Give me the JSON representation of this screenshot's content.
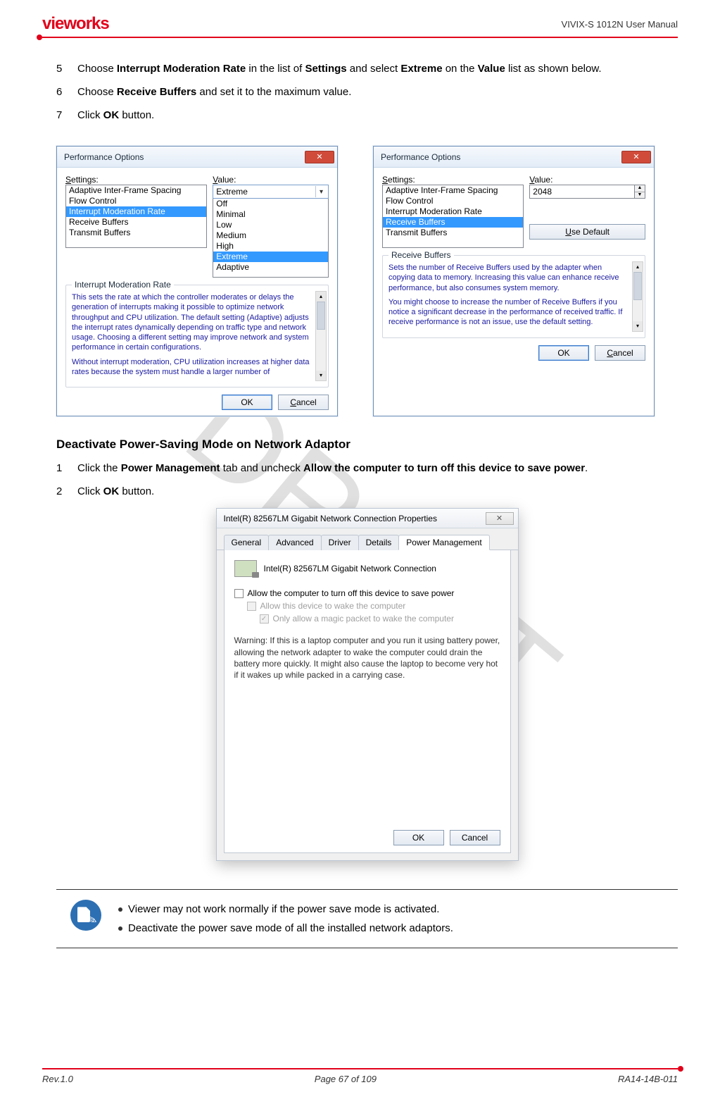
{
  "header": {
    "logo": "vieworks",
    "doc_title": "VIVIX-S 1012N User Manual"
  },
  "watermark": "DRAFT",
  "steps_a": [
    {
      "n": "5",
      "pre": "Choose ",
      "b1": "Interrupt Moderation Rate",
      "mid1": " in the list of ",
      "b2": "Settings",
      "mid2": " and select ",
      "b3": "Extreme",
      "mid3": " on the ",
      "b4": "Value",
      "post": " list as shown below."
    },
    {
      "n": "6",
      "pre": "Choose ",
      "b1": "Receive Buffers",
      "mid1": " and set it to the maximum value."
    },
    {
      "n": "7",
      "pre": "Click ",
      "b1": "OK",
      "mid1": " button."
    }
  ],
  "perf1": {
    "title": "Performance Options",
    "settings_label": "Settings:",
    "value_label": "Value:",
    "settings": [
      "Adaptive Inter-Frame Spacing",
      "Flow Control",
      "Interrupt Moderation Rate",
      "Receive Buffers",
      "Transmit Buffers"
    ],
    "selected_setting_index": 2,
    "value_selected": "Extreme",
    "dropdown": [
      "Off",
      "Minimal",
      "Low",
      "Medium",
      "High",
      "Extreme",
      "Adaptive"
    ],
    "dropdown_sel_index": 5,
    "legend": "Interrupt Moderation Rate",
    "desc_p1": "This sets the rate at which the controller moderates or delays the generation of interrupts making it possible to optimize network throughput and CPU utilization. The default setting (Adaptive) adjusts the interrupt rates dynamically depending on traffic type and network usage. Choosing a different setting may improve network and system performance in certain configurations.",
    "desc_p2": "Without interrupt moderation, CPU utilization increases at higher data rates because the system must handle a larger number of",
    "ok": "OK",
    "cancel": "Cancel"
  },
  "perf2": {
    "title": "Performance Options",
    "settings_label": "Settings:",
    "value_label": "Value:",
    "settings": [
      "Adaptive Inter-Frame Spacing",
      "Flow Control",
      "Interrupt Moderation Rate",
      "Receive Buffers",
      "Transmit Buffers"
    ],
    "selected_setting_index": 3,
    "value_text": "2048",
    "use_default": "Use Default",
    "legend": "Receive Buffers",
    "desc_p1": "Sets the number of Receive Buffers used by the adapter when copying data to memory. Increasing this value can enhance receive performance, but also consumes system memory.",
    "desc_p2": "You might choose to increase the number of Receive Buffers if you notice a significant decrease in the performance of received traffic. If receive performance is not an issue, use the default setting.",
    "ok": "OK",
    "cancel": "Cancel"
  },
  "section_heading": "Deactivate Power-Saving Mode on Network Adaptor",
  "steps_b": [
    {
      "n": "1",
      "pre": "Click the ",
      "b1": "Power Management",
      "mid1": " tab and uncheck ",
      "b2": "Allow the computer to turn off this device to save power",
      "post": "."
    },
    {
      "n": "2",
      "pre": "Click ",
      "b1": "OK",
      "mid1": " button."
    }
  ],
  "net": {
    "title": "Intel(R) 82567LM Gigabit Network Connection Properties",
    "tabs": [
      "General",
      "Advanced",
      "Driver",
      "Details",
      "Power Management"
    ],
    "active_tab_index": 4,
    "device": "Intel(R) 82567LM Gigabit Network Connection",
    "cb1": "Allow the computer to turn off this device to save power",
    "cb2": "Allow this device to wake the computer",
    "cb3": "Only allow a magic packet to wake the computer",
    "warning": "Warning: If this is a laptop computer and you run it using battery power, allowing the network adapter to wake the computer could drain the battery more quickly. It might also cause the laptop to become very hot if it wakes up while packed in a carrying case.",
    "ok": "OK",
    "cancel": "Cancel"
  },
  "notes": [
    "Viewer may not work normally if the power save mode is activated.",
    "Deactivate the power save mode of all the installed network adaptors."
  ],
  "footer": {
    "rev": "Rev.1.0",
    "page": "Page 67 of 109",
    "code": "RA14-14B-011"
  }
}
